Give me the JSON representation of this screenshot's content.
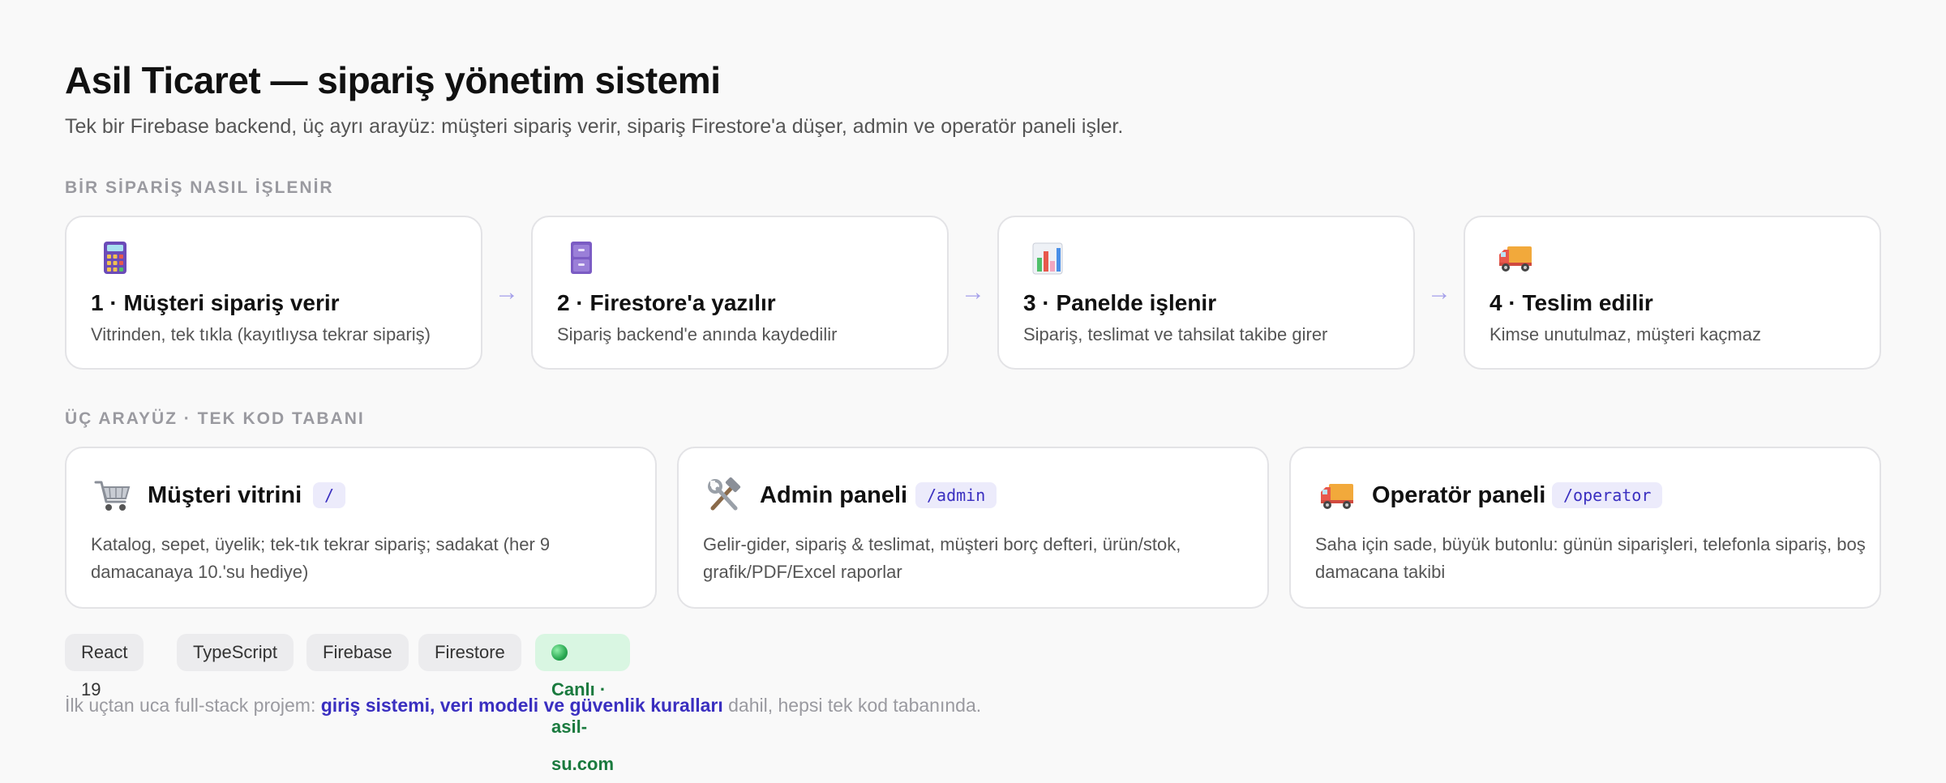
{
  "header": {
    "title": "Asil Ticaret — sipariş yönetim sistemi",
    "subtitle": "Tek bir Firebase backend, üç ayrı arayüz: müşteri sipariş verir, sipariş Firestore'a düşer, admin ve operatör paneli işler."
  },
  "flow": {
    "label": "BİR SİPARİŞ NASIL İŞLENİR",
    "arrow": "→",
    "steps": [
      {
        "icon": "calculator-icon",
        "title": "1 · Müşteri sipariş verir",
        "desc": "Vitrinden, tek tıkla (kayıtlıysa tekrar sipariş)"
      },
      {
        "icon": "file-cabinet-icon",
        "title": "2 · Firestore'a yazılır",
        "desc": "Sipariş backend'e anında kaydedilir"
      },
      {
        "icon": "bar-chart-icon",
        "title": "3 · Panelde işlenir",
        "desc": "Sipariş, teslimat ve tahsilat takibe girer"
      },
      {
        "icon": "delivery-truck-icon",
        "title": "4 · Teslim edilir",
        "desc": "Kimse unutulmaz, müşteri kaçmaz"
      }
    ]
  },
  "interfaces": {
    "label": "ÜÇ ARAYÜZ · TEK KOD TABANI",
    "items": [
      {
        "icon": "shopping-cart-icon",
        "title": "Müşteri vitrini",
        "route": "/",
        "desc": "Katalog, sepet, üyelik; tek-tık tekrar sipariş; sadakat (her 9 damacanaya 10.'su hediye)"
      },
      {
        "icon": "hammer-wrench-icon",
        "title": "Admin paneli",
        "route": "/admin",
        "desc": "Gelir-gider, sipariş & teslimat, müşteri borç defteri, ürün/stok, grafik/PDF/Excel raporlar"
      },
      {
        "icon": "delivery-truck-icon",
        "title": "Operatör paneli",
        "route": "/operator",
        "desc": "Saha için sade, büyük butonlu: günün siparişleri, telefonla sipariş, boş damacana takibi"
      }
    ]
  },
  "tags": [
    "React 19",
    "TypeScript",
    "Firebase",
    "Firestore"
  ],
  "live": {
    "label": "Canlı · asil-su.com"
  },
  "footer": {
    "prefix": "İlk uçtan uca full-stack projem: ",
    "highlight": "giriş sistemi, veri modeli ve güvenlik kuralları",
    "suffix": " dahil, hepsi tek kod tabanında."
  },
  "colors": {
    "accent": "#3a2fc0",
    "arrow": "#a5a0ea",
    "live_bg": "#d9f6e2",
    "live_text": "#1a7a3e"
  }
}
